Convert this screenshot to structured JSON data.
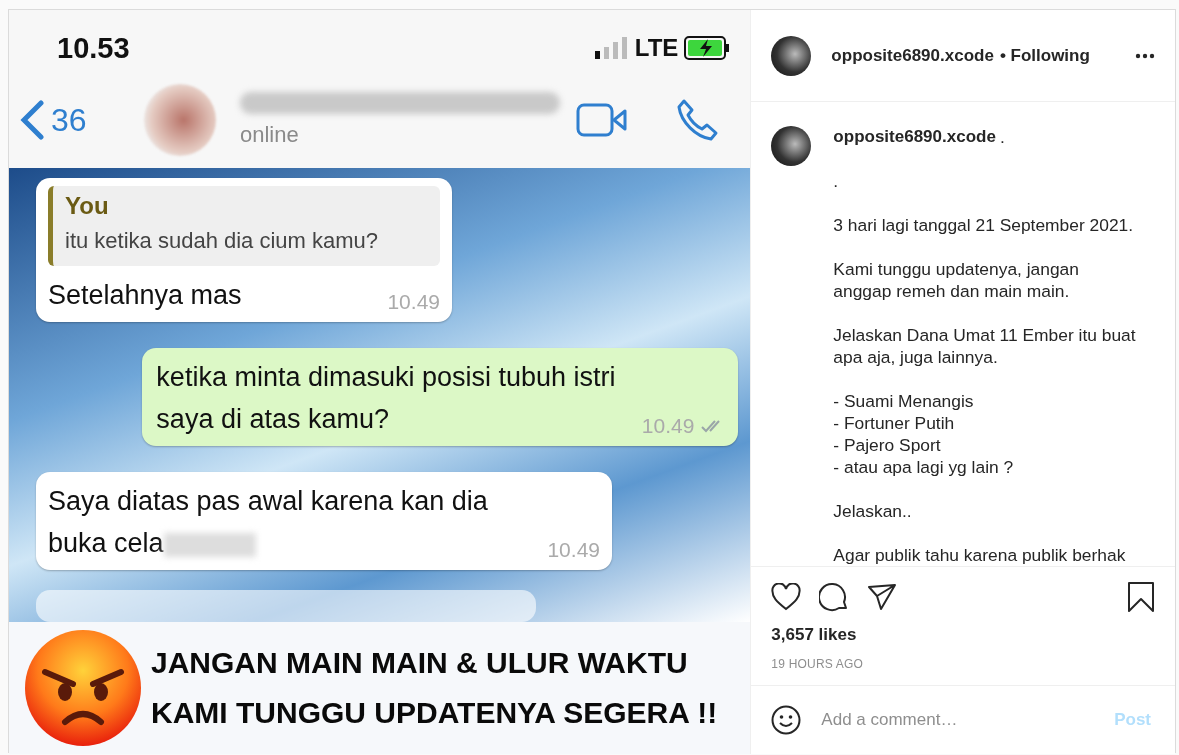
{
  "post_image": {
    "status_bar": {
      "time": "10.53",
      "network": "LTE"
    },
    "chat_header": {
      "back_count": "36",
      "status": "online"
    },
    "messages": [
      {
        "kind": "reply",
        "quote_author": "You",
        "quote_text": "itu ketika sudah dia cium kamu?",
        "text": "Setelahnya mas",
        "time": "10.49"
      },
      {
        "kind": "sent",
        "text": "ketika minta dimasuki  posisi tubuh istri saya di atas kamu?",
        "time": "10.49",
        "read": true
      },
      {
        "kind": "received",
        "text": "Saya diatas pas awal karena kan dia buka cela",
        "time": "10.49"
      }
    ],
    "banner": [
      "JANGAN MAIN MAIN & ULUR WAKTU",
      "KAMI TUNGGU UPDATENYA SEGERA !!"
    ]
  },
  "header": {
    "username": "opposite6890.xcode",
    "follow_status": "• Following"
  },
  "caption": {
    "username": "opposite6890.xcode",
    "lead": ".",
    "paragraphs": [
      [
        "."
      ],
      [
        "3 hari lagi tanggal 21 September 2021."
      ],
      [
        "Kami tunggu updatenya, jangan anggap remeh dan main main."
      ],
      [
        "Jelaskan Dana Umat 11 Ember itu buat apa aja, juga lainnya."
      ],
      [
        "- Suami Menangis",
        "- Fortuner Putih",
        "- Pajero Sport",
        "- atau apa lagi yg lain ?"
      ],
      [
        "Jelaskan.."
      ],
      [
        "Agar publik tahu karena publik berhak"
      ]
    ]
  },
  "likes": "3,657 likes",
  "posted": "19 HOURS AGO",
  "comment": {
    "placeholder": "Add a comment…",
    "post_label": "Post",
    "disabled": true
  }
}
